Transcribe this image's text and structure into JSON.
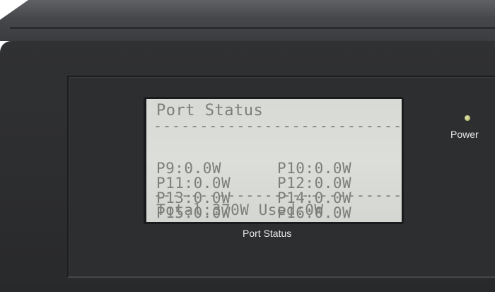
{
  "lcd": {
    "title": "Port Status",
    "divider": "-----------------------------",
    "rows": [
      [
        "P9:0.0W",
        "P10:0.0W"
      ],
      [
        "P11:0.0W",
        "P12:0.0W"
      ],
      [
        "P13:0.0W",
        "P14:0.0W"
      ],
      [
        "P15:0.0W",
        "P16:0.0W"
      ]
    ],
    "footer": "Total:370W Used:0W"
  },
  "labels": {
    "power": "Power",
    "lcd_caption": "Port Status"
  },
  "colors": {
    "chassis": "#2c2d2f",
    "lcd_background": "#d8dad6",
    "lcd_text": "#7c7e7c",
    "power_led": "#c8cc7a",
    "label_text": "#e8e8e8"
  }
}
